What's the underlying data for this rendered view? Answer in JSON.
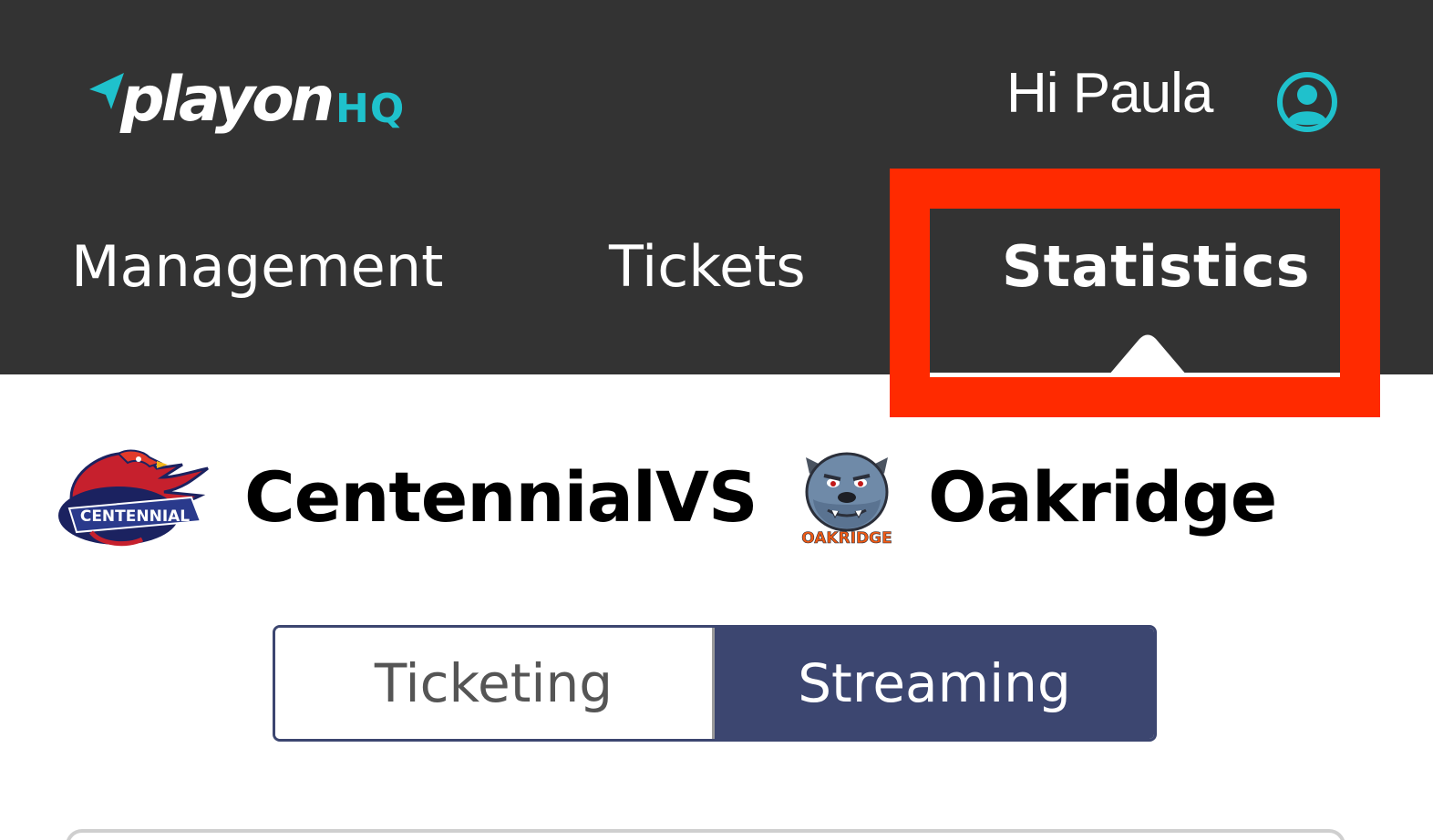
{
  "brand": {
    "name": "playon",
    "suffix": "HQ",
    "colors": {
      "accent": "#1fc1cc",
      "header_bg": "#333333",
      "wordmark": "#ffffff"
    }
  },
  "header": {
    "greeting": "Hi Paula",
    "account_icon": "user-circle-icon"
  },
  "nav": {
    "tabs": [
      {
        "label": "Management",
        "active": false
      },
      {
        "label": "Tickets",
        "active": false
      },
      {
        "label": "Statistics",
        "active": true
      }
    ],
    "highlight_color": "#ff2a00"
  },
  "matchup": {
    "home": {
      "name": "Centennial",
      "logo_text": "CENTENNIAL",
      "logo_icon": "hawk-mascot-icon"
    },
    "separator": "VS",
    "away": {
      "name": "Oakridge",
      "logo_text": "OAKRIDGE",
      "logo_icon": "bulldog-mascot-icon"
    }
  },
  "segmented_control": {
    "options": [
      {
        "label": "Ticketing",
        "selected": false
      },
      {
        "label": "Streaming",
        "selected": true
      }
    ],
    "selected_color": "#3c4670"
  }
}
